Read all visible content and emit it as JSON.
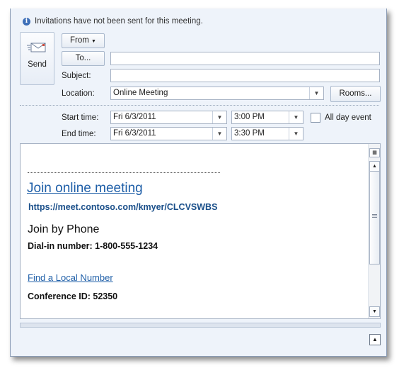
{
  "info_bar": {
    "text": "Invitations have not been sent for this meeting."
  },
  "send": {
    "label": "Send"
  },
  "header": {
    "from_label": "From",
    "to_label": "To...",
    "to_value": "",
    "subject_label": "Subject:",
    "subject_value": "",
    "location_label": "Location:",
    "location_value": "Online Meeting",
    "rooms_label": "Rooms..."
  },
  "times": {
    "start_label": "Start time:",
    "start_date": "Fri 6/3/2011",
    "start_time": "3:00 PM",
    "end_label": "End time:",
    "end_date": "Fri 6/3/2011",
    "end_time": "3:30 PM",
    "all_day_label": "All day event",
    "all_day_checked": false
  },
  "body": {
    "join_link": "Join online meeting",
    "url": "https://meet.contoso.com/kmyer/CLCVSWBS",
    "phone_heading": "Join by Phone",
    "dialin": "Dial-in number:  1-800-555-1234",
    "local_link": "Find a Local Number",
    "conference_id": "Conference ID:  52350"
  },
  "icons": [
    "info-icon",
    "envelope-icon",
    "chevron-down-icon",
    "scroll-up-icon",
    "scroll-down-icon",
    "resize-icon"
  ],
  "colors": {
    "link": "#1f5fa8",
    "window_bg": "#eef3fa",
    "border": "#a6b2c4"
  }
}
